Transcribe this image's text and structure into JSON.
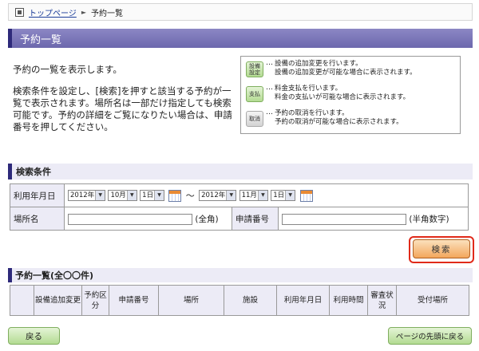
{
  "breadcrumb": {
    "home": "トップページ",
    "separator": "►",
    "current": "予約一覧"
  },
  "page_title": "予約一覧",
  "intro": [
    "予約の一覧を表示します。",
    "検索条件を設定し、[検索]を押すと該当する予約が一覧で表示されます。場所名は一部だけ指定しても検索可能です。予約の詳細をご覧になりたい場合は、申請番号を押してください。"
  ],
  "legend": [
    {
      "button": "設備設定",
      "line1": "設備の追加変更を行います。",
      "line2": "設備の追加変更が可能な場合に表示されます。"
    },
    {
      "button": "支払",
      "line1": "料金支払を行います。",
      "line2": "料金の支払いが可能な場合に表示されます。"
    },
    {
      "button": "取消",
      "line1": "予約の取消を行います。",
      "line2": "予約の取消が可能な場合に表示されます。"
    }
  ],
  "legend_dots": "…",
  "search": {
    "section_title": "検索条件",
    "date_label": "利用年月日",
    "from": {
      "year": "2012年",
      "month": "10月",
      "day": "1日"
    },
    "tilde": "〜",
    "to": {
      "year": "2012年",
      "month": "11月",
      "day": "1日"
    },
    "place_label": "場所名",
    "place_hint": "(全角)",
    "app_no_label": "申請番号",
    "app_no_hint": "(半角数字)",
    "button": "検索"
  },
  "list": {
    "title": "予約一覧(全〇〇件)",
    "columns": [
      "",
      "設備追加変更",
      "予約区分",
      "申請番号",
      "場所",
      "施設",
      "利用年月日",
      "利用時間",
      "審査状況",
      "受付場所"
    ]
  },
  "footer": {
    "back": "戻る",
    "top": "ページの先頭に戻る"
  }
}
